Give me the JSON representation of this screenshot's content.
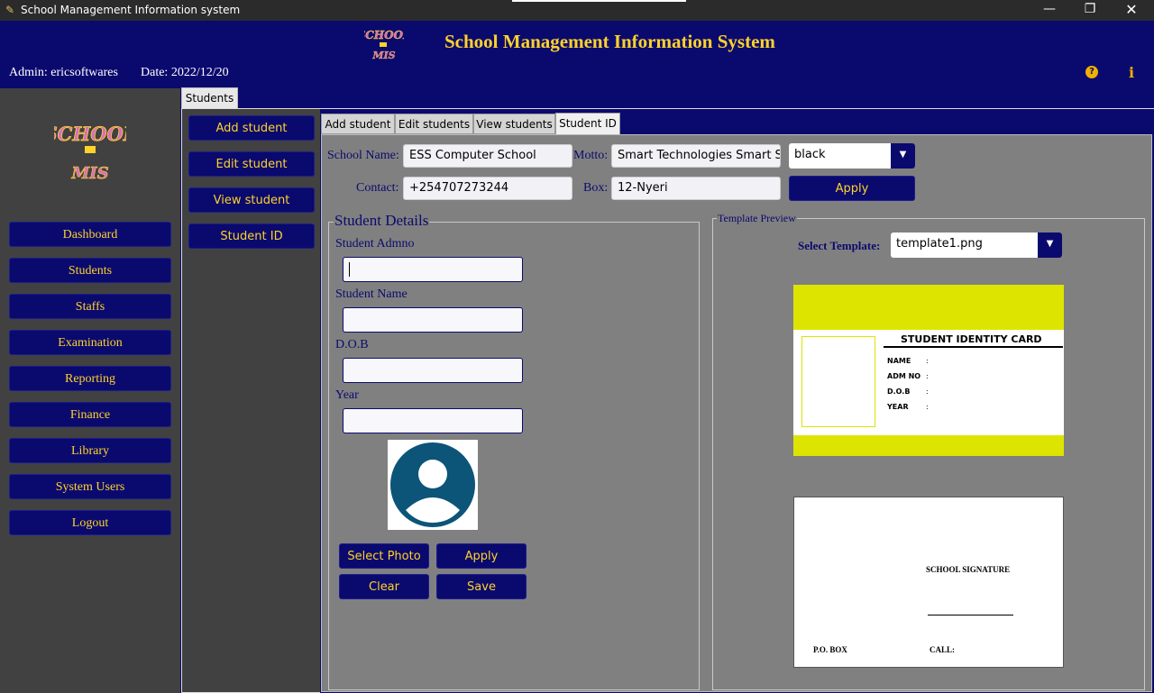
{
  "window": {
    "title": "School Management Information system",
    "controls": {
      "minimize": "—",
      "maximize": "❐",
      "close": "✕"
    }
  },
  "header": {
    "title": "School Management Information System",
    "admin": "Admin: ericsoftwares",
    "date": "Date: 2022/12/20",
    "logo_text_top": "SCHOOL",
    "logo_text_bottom": "MIS"
  },
  "sidebar": {
    "items": [
      {
        "label": "Dashboard"
      },
      {
        "label": "Students"
      },
      {
        "label": "Staffs"
      },
      {
        "label": "Examination"
      },
      {
        "label": "Reporting"
      },
      {
        "label": "Finance"
      },
      {
        "label": "Library"
      },
      {
        "label": "System Users"
      },
      {
        "label": "Logout"
      }
    ]
  },
  "tabs": {
    "students": "Students"
  },
  "student_menu": {
    "items": [
      {
        "label": "Add student"
      },
      {
        "label": "Edit student"
      },
      {
        "label": "View student"
      },
      {
        "label": "Student ID"
      }
    ]
  },
  "inner_tabs": [
    {
      "label": "Add student"
    },
    {
      "label": "Edit students"
    },
    {
      "label": "View students"
    },
    {
      "label": "Student ID"
    }
  ],
  "school_form": {
    "school_name_label": "School Name:",
    "school_name_value": "ESS Computer School",
    "motto_label": "Motto:",
    "motto_value": "Smart Technologies Smart Serv",
    "contact_label": "Contact:",
    "contact_value": "+254707273244",
    "box_label": "Box:",
    "box_value": "12-Nyeri",
    "color_value": "black",
    "apply_label": "Apply"
  },
  "student_details": {
    "title": "Student Details",
    "admno_label": "Student Admno",
    "name_label": "Student Name",
    "dob_label": "D.O.B",
    "year_label": "Year",
    "select_photo_label": "Select Photo",
    "apply_label": "Apply",
    "clear_label": "Clear",
    "save_label": "Save"
  },
  "template_preview": {
    "title": "Template Preview",
    "select_label": "Select Template:",
    "selected": "template1.png",
    "card_title": "STUDENT IDENTITY CARD",
    "fields": [
      "NAME",
      "ADM NO",
      "D.O.B",
      "YEAR"
    ],
    "colon": ":",
    "back_signature": "SCHOOL SIGNATURE",
    "back_pobox": "P.O. BOX",
    "back_call": "CALL:"
  },
  "colors": {
    "navy": "#0a0a6e",
    "gold": "#ffd22a",
    "card_yellow": "#dde400",
    "panel_gray": "#808080"
  }
}
